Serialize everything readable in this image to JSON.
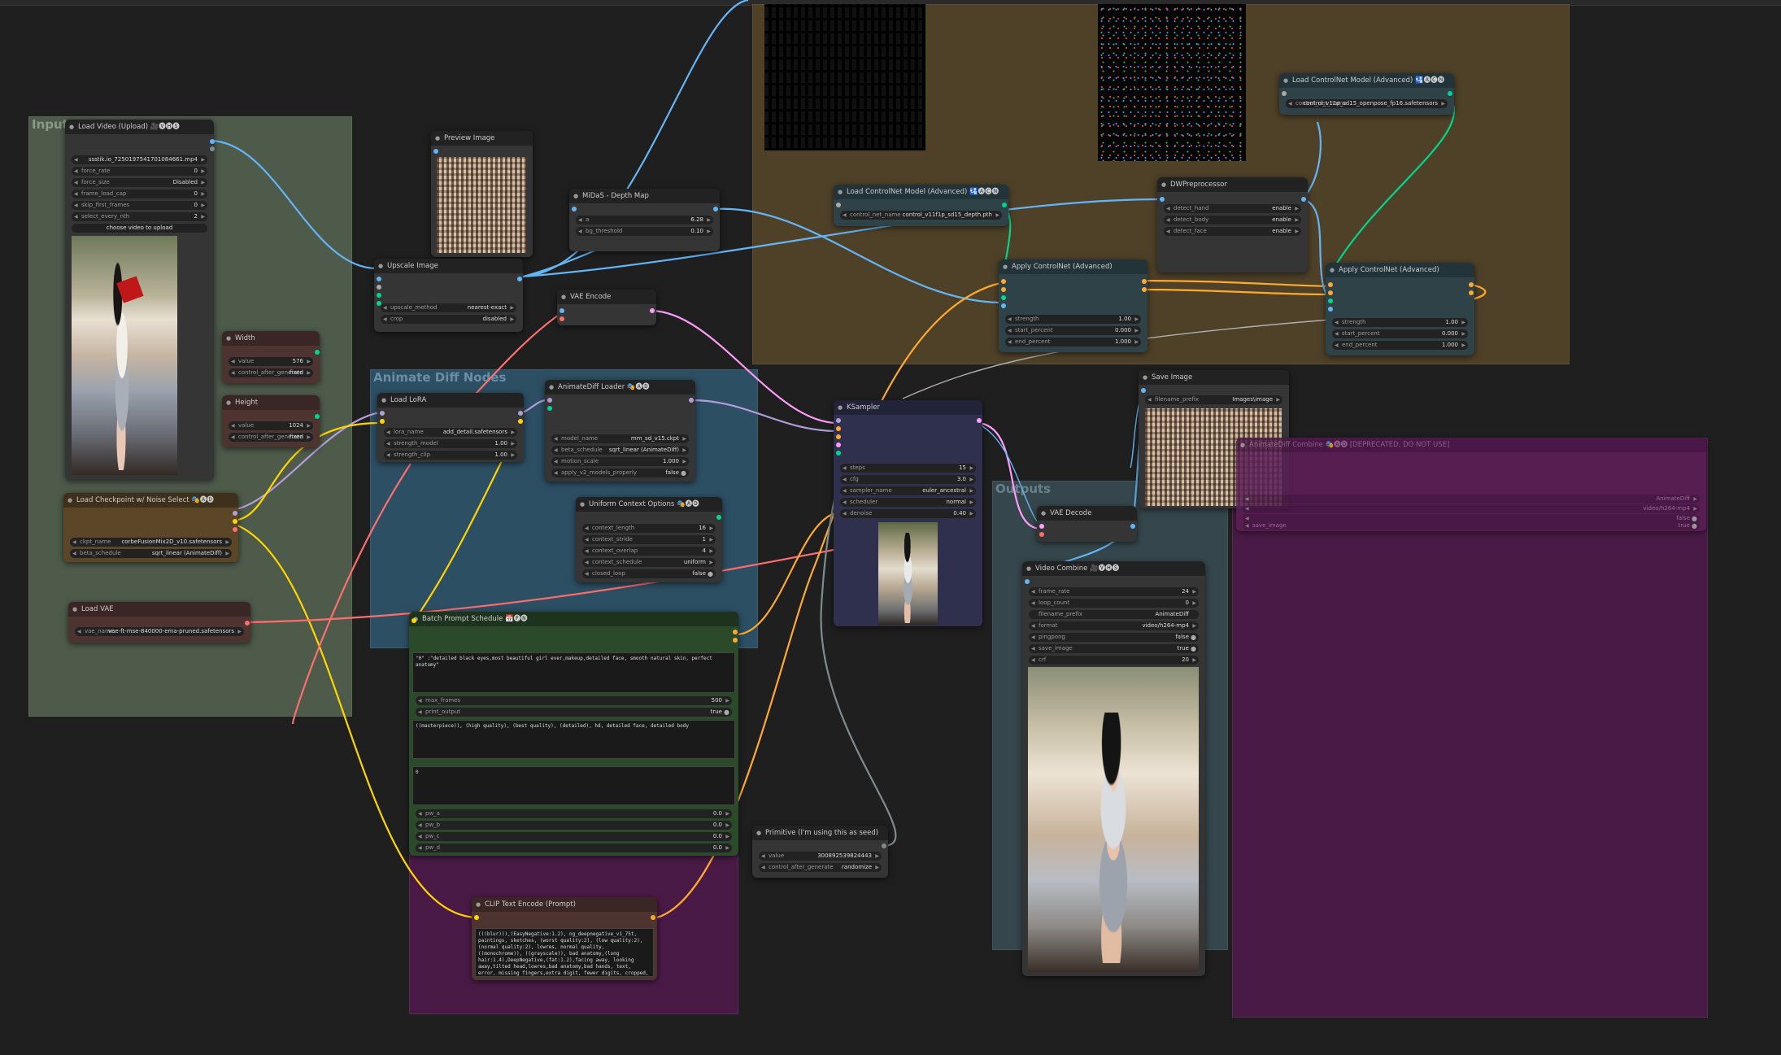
{
  "groups": {
    "inputs": "Inputs",
    "animate_diff": "Animate Diff Nodes",
    "outputs": "Outputs"
  },
  "nodes": {
    "load_video": {
      "title": "Load Video (Upload) 🎥🅥🅗🅢",
      "widgets": [
        {
          "label": "",
          "value": "ssstik.io_7250197541701084661.mp4"
        },
        {
          "label": "force_rate",
          "value": "0"
        },
        {
          "label": "force_size",
          "value": "Disabled"
        },
        {
          "label": "frame_load_cap",
          "value": "0"
        },
        {
          "label": "skip_first_frames",
          "value": "0"
        },
        {
          "label": "select_every_nth",
          "value": "2"
        }
      ],
      "upload_button": "choose video to upload"
    },
    "preview_image": {
      "title": "Preview Image"
    },
    "upscale_image": {
      "title": "Upscale Image",
      "widgets": [
        {
          "label": "upscale_method",
          "value": "nearest-exact"
        },
        {
          "label": "crop",
          "value": "disabled"
        }
      ]
    },
    "width": {
      "title": "Width",
      "widgets": [
        {
          "label": "value",
          "value": "576"
        },
        {
          "label": "control_after_generate",
          "value": "fixed"
        }
      ]
    },
    "height": {
      "title": "Height",
      "widgets": [
        {
          "label": "value",
          "value": "1024"
        },
        {
          "label": "control_after_generate",
          "value": "fixed"
        }
      ]
    },
    "load_checkpoint": {
      "title": "Load Checkpoint w/ Noise Select 🎭🅐🅓",
      "widgets": [
        {
          "label": "ckpt_name",
          "value": "corbeFusionMix2D_v10.safetensors"
        },
        {
          "label": "beta_schedule",
          "value": "sqrt_linear (AnimateDiff)"
        }
      ]
    },
    "load_vae": {
      "title": "Load VAE",
      "widgets": [
        {
          "label": "vae_name",
          "value": "vae-ft-mse-840000-ema-pruned.safetensors"
        }
      ]
    },
    "midas": {
      "title": "MiDaS - Depth Map",
      "widgets": [
        {
          "label": "a",
          "value": "6.28"
        },
        {
          "label": "bg_threshold",
          "value": "0.10"
        }
      ]
    },
    "vae_encode": {
      "title": "VAE Encode"
    },
    "load_lora": {
      "title": "Load LoRA",
      "widgets": [
        {
          "label": "lora_name",
          "value": "add_detail.safetensors"
        },
        {
          "label": "strength_model",
          "value": "1.00"
        },
        {
          "label": "strength_clip",
          "value": "1.00"
        }
      ]
    },
    "animatediff_loader": {
      "title": "AnimateDiff Loader 🎭🅐🅓",
      "widgets": [
        {
          "label": "model_name",
          "value": "mm_sd_v15.ckpt"
        },
        {
          "label": "beta_schedule",
          "value": "sqrt_linear (AnimateDiff)"
        },
        {
          "label": "motion_scale",
          "value": "1.000"
        },
        {
          "label": "apply_v2_models_properly",
          "value": "false"
        }
      ]
    },
    "uniform_context": {
      "title": "Uniform Context Options 🎭🅐🅓",
      "widgets": [
        {
          "label": "context_length",
          "value": "16"
        },
        {
          "label": "context_stride",
          "value": "1"
        },
        {
          "label": "context_overlap",
          "value": "4"
        },
        {
          "label": "context_schedule",
          "value": "uniform"
        },
        {
          "label": "closed_loop",
          "value": "false"
        }
      ]
    },
    "batch_prompt": {
      "title": "Batch Prompt Schedule 📅🅕🅝",
      "text": "\"0\" :\"detailed black eyes,most beautiful girl ever,makeup,detailed face, smooth natural skin, perfect anatomy\"",
      "widgets": [
        {
          "label": "max_frames",
          "value": "500"
        },
        {
          "label": "print_output",
          "value": "true"
        }
      ],
      "pre_text": "((masterpiece)), (high quality), (best quality), (detailed), hd, detailed face, detailed body",
      "app_text": "0",
      "pw_widgets": [
        {
          "label": "pw_a",
          "value": "0.0"
        },
        {
          "label": "pw_b",
          "value": "0.0"
        },
        {
          "label": "pw_c",
          "value": "0.0"
        },
        {
          "label": "pw_d",
          "value": "0.0"
        }
      ]
    },
    "clip_text_encode": {
      "title": "CLIP Text Encode (Prompt)",
      "text": "(((blur))),(EasyNegative:1.2), ng_deepnegative_v1_75t, paintings, sketches, (worst quality:2), (low quality:2), (normal quality:2), lowres, normal quality, ((monochrome)), ((grayscale)), bad anatomy,(long hair:1.4),DeepNegative,(fat:1.2),facing away, looking away,tilted head,lowres,bad anatomy,bad hands, text, error, missing fingers,extra digit, fewer digits, cropped, worstquality, low quality, normal quality,jpegartifacts,signature, watermark, username,blurry,bad"
    },
    "load_controlnet_1": {
      "title": "Load ControlNet Model (Advanced) 🛂🅐🅒🅝",
      "widgets": [
        {
          "label": "control_net_name",
          "value": "control_v11f1p_sd15_depth.pth"
        }
      ]
    },
    "load_controlnet_2": {
      "title": "Load ControlNet Model (Advanced) 🛂🅐🅒🅝",
      "widgets": [
        {
          "label": "control_net_name",
          "value": "control_v11p_sd15_openpose_fp16.safetensors"
        }
      ]
    },
    "dwpreprocessor": {
      "title": "DWPreprocessor",
      "widgets": [
        {
          "label": "detect_hand",
          "value": "enable"
        },
        {
          "label": "detect_body",
          "value": "enable"
        },
        {
          "label": "detect_face",
          "value": "enable"
        }
      ]
    },
    "apply_controlnet_1": {
      "title": "Apply ControlNet (Advanced)",
      "widgets": [
        {
          "label": "strength",
          "value": "1.00"
        },
        {
          "label": "start_percent",
          "value": "0.000"
        },
        {
          "label": "end_percent",
          "value": "1.000"
        }
      ]
    },
    "apply_controlnet_2": {
      "title": "Apply ControlNet (Advanced)",
      "widgets": [
        {
          "label": "strength",
          "value": "1.00"
        },
        {
          "label": "start_percent",
          "value": "0.000"
        },
        {
          "label": "end_percent",
          "value": "1.000"
        }
      ]
    },
    "ksampler": {
      "title": "KSampler",
      "widgets": [
        {
          "label": "steps",
          "value": "15"
        },
        {
          "label": "cfg",
          "value": "3.0"
        },
        {
          "label": "sampler_name",
          "value": "euler_ancestral"
        },
        {
          "label": "scheduler",
          "value": "normal"
        },
        {
          "label": "denoise",
          "value": "0.40"
        }
      ]
    },
    "save_image": {
      "title": "Save Image",
      "widgets": [
        {
          "label": "filename_prefix",
          "value": "Images\\image"
        }
      ]
    },
    "vae_decode": {
      "title": "VAE Decode"
    },
    "video_combine": {
      "title": "Video Combine 🎥🅥🅗🅢",
      "widgets": [
        {
          "label": "frame_rate",
          "value": "24"
        },
        {
          "label": "loop_count",
          "value": "0"
        },
        {
          "label": "filename_prefix",
          "value": "AnimateDiff"
        },
        {
          "label": "format",
          "value": "video/h264-mp4"
        },
        {
          "label": "pingpong",
          "value": "false"
        },
        {
          "label": "save_image",
          "value": "true"
        },
        {
          "label": "crf",
          "value": "20"
        }
      ]
    },
    "primitive": {
      "title": "Primitive (I'm using this as seed)",
      "widgets": [
        {
          "label": "value",
          "value": "300892539824443"
        },
        {
          "label": "control_after_generate",
          "value": "randomize"
        }
      ]
    },
    "deprecated": {
      "title": "AnimateDiff Combine 🎭🅐🅓 [DEPRECATED, DO NOT USE]",
      "widgets": [
        {
          "label": "",
          "value": "AnimateDiff"
        },
        {
          "label": "",
          "value": "video/h264-mp4"
        }
      ],
      "toggles": [
        {
          "label": "",
          "value": "false"
        },
        {
          "label": "save_image",
          "value": "true"
        }
      ]
    }
  },
  "colors": {
    "canvas": "#1f1f1f",
    "group_inputs": "#4e5b4b",
    "group_animatediff": "#2d4f63",
    "group_outputs": "#35474c",
    "group_controlnet": "#4f4128",
    "group_deprecated": "#4a1a46",
    "link_image": "#64b5f6",
    "link_model": "#b39ddb",
    "link_clip": "#ffd500",
    "link_vae": "#ff6e6e",
    "link_conditioning": "#ffa931",
    "link_latent": "#ff9cf9",
    "link_control_net": "#00d78d",
    "link_int": "#7f8c8d"
  }
}
